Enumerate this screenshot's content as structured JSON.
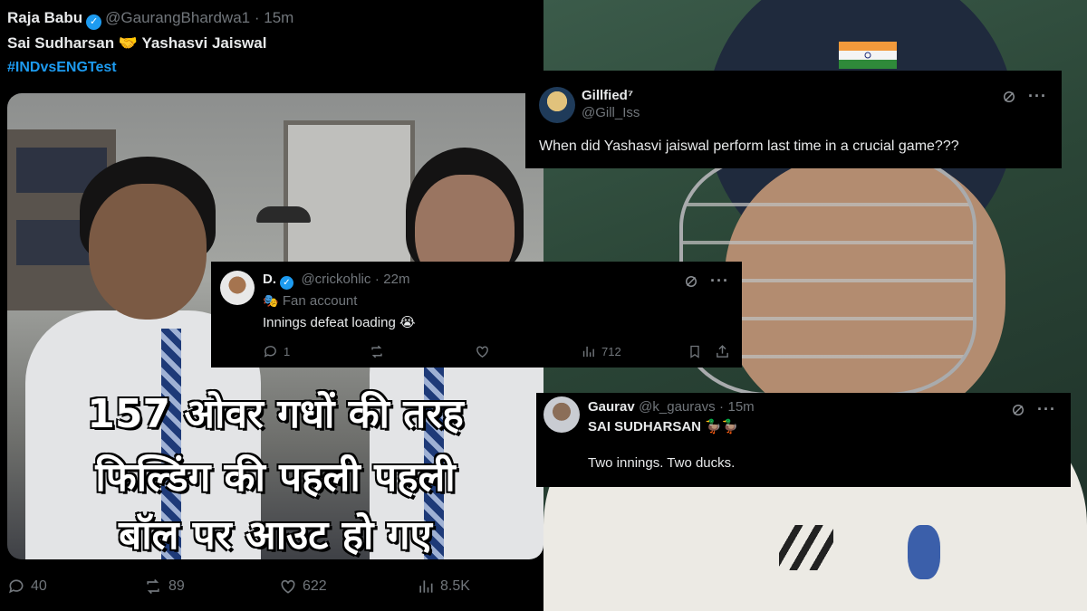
{
  "left_tweet": {
    "display_name": "Raja Babu",
    "verified_mark": "✓",
    "handle": "@GaurangBhardwa1",
    "separator": "·",
    "time": "15m",
    "text_line1_a": "Sai Sudharsan",
    "text_line1_emoji": "🤝",
    "text_line1_b": "Yashasvi Jaiswal",
    "hashtag": "#INDvsENGTest",
    "meme_text": [
      "157 ओवर गधों की तरह",
      "फिल्डिंग की पहली पहली",
      "बॉल पर आउट हो गए"
    ],
    "actions": {
      "replies": "40",
      "reposts": "89",
      "likes": "622",
      "views": "8.5K"
    }
  },
  "gillfied_card": {
    "display_name": "Gillfied⁷",
    "handle": "@Gill_Iss",
    "text": "When did Yashasvi jaiswal perform last time in a crucial game???",
    "more": "···"
  },
  "d_card": {
    "display_name": "D.",
    "verified_mark": "✓",
    "handle": "@crickohlic",
    "separator": "·",
    "time": "22m",
    "bio_icon": "🎭",
    "bio": "Fan account",
    "text": "Innings defeat loading 😭",
    "more": "···",
    "actions": {
      "replies": "1",
      "views": "712"
    }
  },
  "gaurav_card": {
    "display_name": "Gaurav",
    "handle": "@k_gauravs",
    "separator": "·",
    "time": "15m",
    "text_line1": "SAI SUDHARSAN 🦆🦆",
    "text_line2": "Two innings. Two ducks.",
    "more": "···"
  },
  "colors": {
    "accent": "#1d9bf0",
    "muted": "#71767b",
    "text": "#e7e9ea",
    "background": "#000000"
  }
}
